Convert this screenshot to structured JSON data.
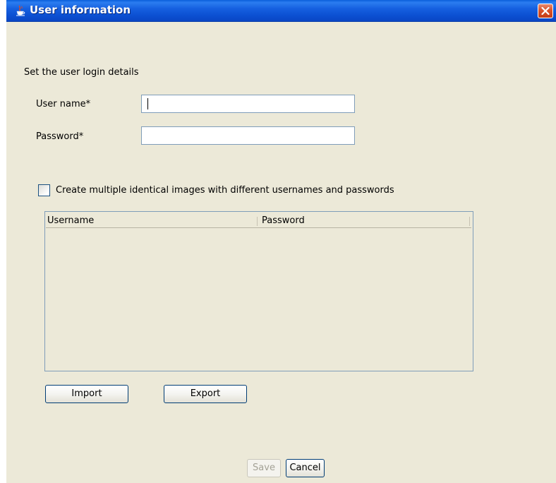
{
  "window": {
    "title": "User information",
    "close_icon": "close-icon",
    "app_icon": "java-cup-icon"
  },
  "form": {
    "section_heading": "Set the user login details",
    "username_label": "User name*",
    "username_value": "",
    "password_label": "Password*",
    "password_value": "",
    "multiple_images_checkbox": {
      "label": "Create multiple identical images with different usernames and passwords",
      "checked": false
    }
  },
  "table": {
    "columns": [
      "Username",
      "Password"
    ],
    "rows": []
  },
  "buttons": {
    "import": "Import",
    "export": "Export",
    "save": "Save",
    "save_enabled": false,
    "cancel": "Cancel"
  },
  "colors": {
    "titlebar": "#0b4fd1",
    "window_bg": "#ece9d8",
    "field_border": "#7f9db9",
    "close_button": "#d9532b"
  }
}
